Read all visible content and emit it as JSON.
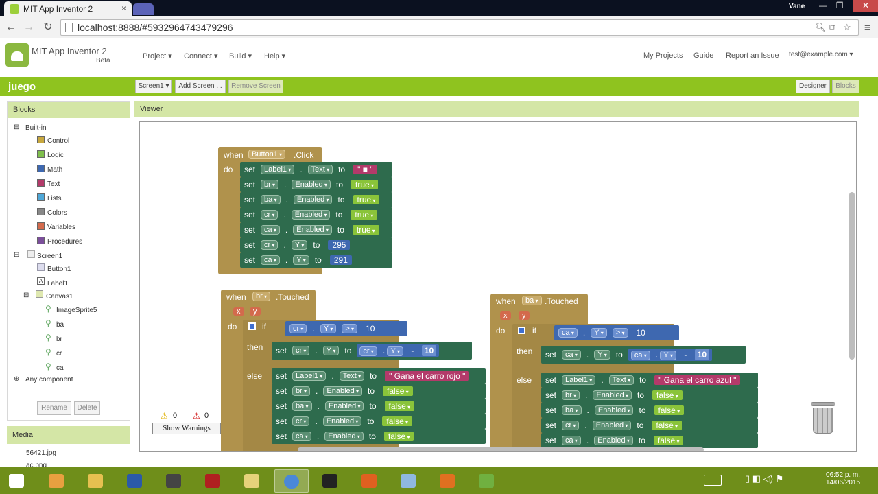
{
  "browser": {
    "tab_title": "MIT App Inventor 2",
    "tab_close": "×",
    "user": "Vane",
    "url": "localhost:8888/#5932964743479296",
    "minimize": "—",
    "maximize": "❐",
    "close": "✕"
  },
  "app": {
    "title": "MIT App Inventor 2",
    "subtitle": "Beta",
    "menus": [
      "Project ▾",
      "Connect ▾",
      "Build ▾",
      "Help ▾"
    ],
    "right_links": [
      "My Projects",
      "Guide",
      "Report an Issue",
      "test@example.com ▾"
    ]
  },
  "toolbar": {
    "project_name": "juego",
    "screen_select": "Screen1 ▾",
    "add_screen": "Add Screen ...",
    "remove_screen": "Remove Screen",
    "designer": "Designer",
    "blocks": "Blocks"
  },
  "blocks_panel": {
    "title": "Blocks",
    "builtin": "Built-in",
    "builtin_items": [
      {
        "label": "Control",
        "color": "#c8a83e"
      },
      {
        "label": "Logic",
        "color": "#7fbf4c"
      },
      {
        "label": "Math",
        "color": "#3e68b0"
      },
      {
        "label": "Text",
        "color": "#b33a6a"
      },
      {
        "label": "Lists",
        "color": "#4fa8d8"
      },
      {
        "label": "Colors",
        "color": "#888888"
      },
      {
        "label": "Variables",
        "color": "#d36a4c"
      },
      {
        "label": "Procedures",
        "color": "#7b4f9a"
      }
    ],
    "screen": "Screen1",
    "button": "Button1",
    "label": "Label1",
    "canvas": "Canvas1",
    "sprites": [
      "ImageSprite5",
      "ba",
      "br",
      "cr",
      "ca"
    ],
    "any_component": "Any component",
    "rename": "Rename",
    "delete": "Delete"
  },
  "media": {
    "title": "Media",
    "files": [
      "56421.jpg",
      "ac.png"
    ]
  },
  "viewer": {
    "title": "Viewer",
    "warnings_count": "0",
    "errors_count": "0",
    "show_warnings": "Show Warnings"
  },
  "blocks": {
    "click_event": {
      "when": "when",
      "component": "Button1",
      "event": ".Click",
      "do": "do",
      "rows": [
        {
          "set": "set",
          "comp": "Label1",
          "prop": "Text",
          "to": "to",
          "value": "\" ■ \"",
          "kind": "txt"
        },
        {
          "set": "set",
          "comp": "br",
          "prop": "Enabled",
          "to": "to",
          "value": "true",
          "kind": "lit"
        },
        {
          "set": "set",
          "comp": "ba",
          "prop": "Enabled",
          "to": "to",
          "value": "true",
          "kind": "lit"
        },
        {
          "set": "set",
          "comp": "cr",
          "prop": "Enabled",
          "to": "to",
          "value": "true",
          "kind": "lit"
        },
        {
          "set": "set",
          "comp": "ca",
          "prop": "Enabled",
          "to": "to",
          "value": "true",
          "kind": "lit"
        },
        {
          "set": "set",
          "comp": "cr",
          "prop": "Y",
          "to": "to",
          "value": "295",
          "kind": "num"
        },
        {
          "set": "set",
          "comp": "ca",
          "prop": "Y",
          "to": "to",
          "value": "291",
          "kind": "num"
        }
      ]
    },
    "br_touched": {
      "when": "when",
      "component": "br",
      "event": ".Touched",
      "x": "x",
      "y": "y",
      "do": "do",
      "if": "if",
      "then": "then",
      "else": "else",
      "cond_comp": "cr",
      "cond_prop": "Y",
      "op": ">",
      "cond_val": "10",
      "then_set": "set",
      "then_comp": "cr",
      "then_prop": "Y",
      "then_to": "to",
      "then_expr_comp": "cr",
      "then_expr_prop": "Y",
      "minus": "-",
      "then_val": "10",
      "else_rows": [
        {
          "set": "set",
          "comp": "Label1",
          "prop": "Text",
          "to": "to",
          "value": "\" Gana el carro rojo \"",
          "kind": "txt"
        },
        {
          "set": "set",
          "comp": "br",
          "prop": "Enabled",
          "to": "to",
          "value": "false",
          "kind": "lit"
        },
        {
          "set": "set",
          "comp": "ba",
          "prop": "Enabled",
          "to": "to",
          "value": "false",
          "kind": "lit"
        },
        {
          "set": "set",
          "comp": "cr",
          "prop": "Enabled",
          "to": "to",
          "value": "false",
          "kind": "lit"
        },
        {
          "set": "set",
          "comp": "ca",
          "prop": "Enabled",
          "to": "to",
          "value": "false",
          "kind": "lit"
        }
      ]
    },
    "ba_touched": {
      "when": "when",
      "component": "ba",
      "event": ".Touched",
      "x": "x",
      "y": "y",
      "do": "do",
      "if": "if",
      "then": "then",
      "else": "else",
      "cond_comp": "ca",
      "cond_prop": "Y",
      "op": ">",
      "cond_val": "10",
      "then_set": "set",
      "then_comp": "ca",
      "then_prop": "Y",
      "then_to": "to",
      "then_expr_comp": "ca",
      "then_expr_prop": "Y",
      "minus": "-",
      "then_val": "10",
      "else_rows": [
        {
          "set": "set",
          "comp": "Label1",
          "prop": "Text",
          "to": "to",
          "value": "\" Gana el carro azul \"",
          "kind": "txt"
        },
        {
          "set": "set",
          "comp": "br",
          "prop": "Enabled",
          "to": "to",
          "value": "false",
          "kind": "lit"
        },
        {
          "set": "set",
          "comp": "ba",
          "prop": "Enabled",
          "to": "to",
          "value": "false",
          "kind": "lit"
        },
        {
          "set": "set",
          "comp": "cr",
          "prop": "Enabled",
          "to": "to",
          "value": "false",
          "kind": "lit"
        },
        {
          "set": "set",
          "comp": "ca",
          "prop": "Enabled",
          "to": "to",
          "value": "false",
          "kind": "lit"
        }
      ]
    }
  },
  "taskbar": {
    "time": "06:52 p. m.",
    "date": "14/06/2015",
    "icons": [
      "windows-start-icon",
      "apps-grid-icon",
      "file-explorer-icon",
      "word-icon",
      "sublime-icon",
      "filezilla-icon",
      "folder-icon",
      "chrome-icon",
      "terminal-icon",
      "app-icon",
      "tablet-icon",
      "media-player-icon",
      "stack-icon"
    ]
  }
}
